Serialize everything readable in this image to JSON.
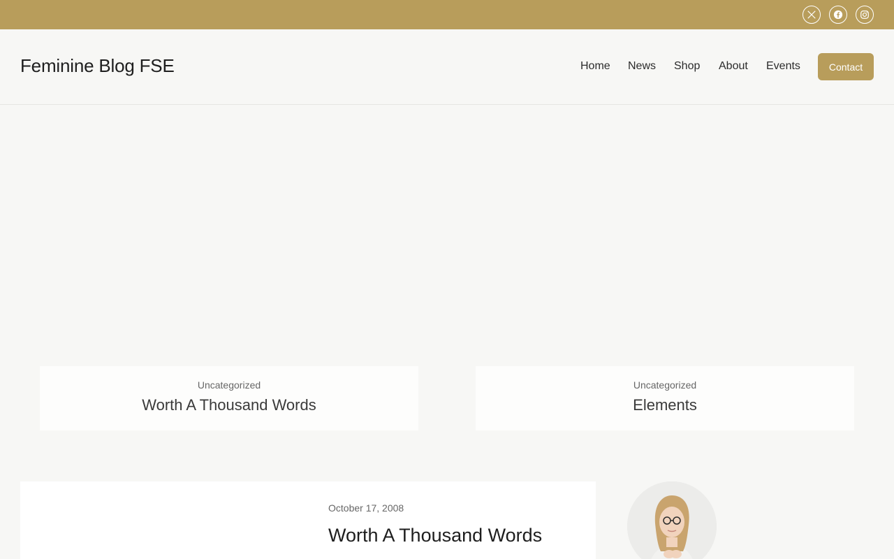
{
  "social": [
    {
      "name": "x",
      "icon": "x-icon"
    },
    {
      "name": "facebook",
      "icon": "facebook-icon"
    },
    {
      "name": "instagram",
      "icon": "instagram-icon"
    }
  ],
  "header": {
    "site_title": "Feminine Blog FSE",
    "nav": [
      "Home",
      "News",
      "Shop",
      "About",
      "Events"
    ],
    "contact_label": "Contact"
  },
  "featured": [
    {
      "category": "Uncategorized",
      "title": "Worth A Thousand Words"
    },
    {
      "category": "Uncategorized",
      "title": "Elements"
    }
  ],
  "post": {
    "date": "October 17, 2008",
    "title": "Worth A Thousand Words"
  },
  "colors": {
    "accent": "#b89d5b",
    "background": "#f7f7f5",
    "text": "#1e1e1e"
  }
}
